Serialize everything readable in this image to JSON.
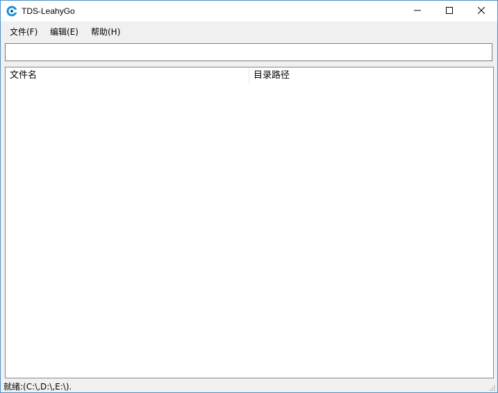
{
  "window": {
    "title": "TDS-LeahyGo",
    "app_icon": "app-logo-icon",
    "controls": {
      "minimize_icon": "minimize-icon",
      "maximize_icon": "maximize-icon",
      "close_icon": "close-icon"
    }
  },
  "menubar": {
    "items": [
      {
        "label": "文件(F)"
      },
      {
        "label": "编辑(E)"
      },
      {
        "label": "帮助(H)"
      }
    ]
  },
  "search": {
    "value": "",
    "placeholder": ""
  },
  "list": {
    "columns": [
      {
        "label": "文件名"
      },
      {
        "label": "目录路径"
      }
    ],
    "rows": []
  },
  "statusbar": {
    "text": "就绪:(C:\\,D:\\,E:\\)."
  },
  "colors": {
    "window_border": "#4d8fc9",
    "chrome_bg": "#f0f0f0",
    "accent_icon": "#1b8fd6"
  }
}
